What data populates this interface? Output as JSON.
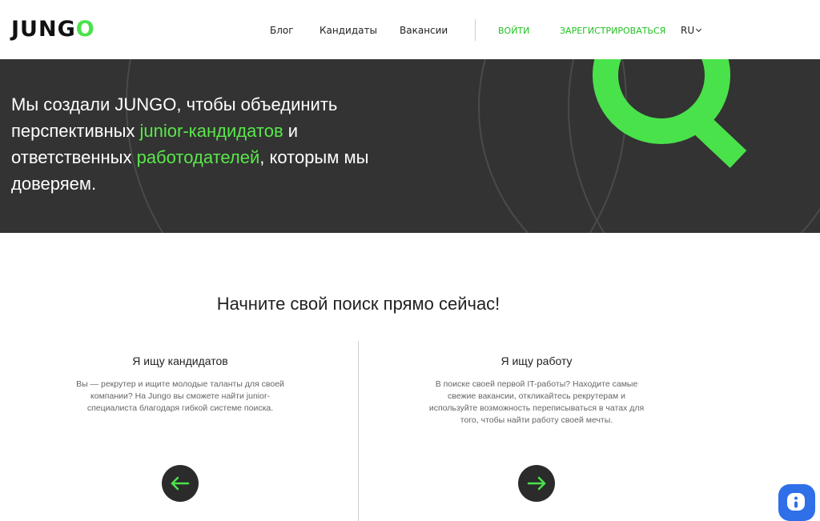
{
  "header": {
    "logo_text": "JUNG",
    "logo_accent": "O",
    "nav": {
      "blog": "Блог",
      "candidates": "Кандидаты",
      "vacancies": "Вакансии",
      "login": "ВОЙТИ",
      "register": "ЗАРЕГИСТРИРОВАТЬСЯ",
      "language": "RU"
    }
  },
  "hero": {
    "text_1": "Мы создали JUNGO, чтобы объединить перспективных ",
    "highlight_1": "junior-кандидатов",
    "text_2": " и ответственных ",
    "highlight_2": "работодателей",
    "text_3": ", которым мы доверяем."
  },
  "main": {
    "title": "Начните свой поиск прямо сейчас!",
    "cards": [
      {
        "title": "Я ищу кандидатов",
        "text": "Вы — рекрутер и ищите молодые таланты для своей компании? На Jungo вы сможете найти junior-специалиста благодаря гибкой системе поиска.",
        "arrow": "arrow-left-icon"
      },
      {
        "title": "Я ищу работу",
        "text": "В поиске своей первой IT-работы? Находите самые свежие вакансии, откликайтесь рекрутерам и используйте возможность переписываться в чатах для того, чтобы найти работу своей мечты.",
        "arrow": "arrow-right-icon"
      }
    ]
  },
  "chat_widget": {
    "icon": "chat-icon"
  },
  "colors": {
    "accent_green": "#4ae24a",
    "hero_background": "#333333",
    "chat_blue": "#2f6fe8"
  }
}
